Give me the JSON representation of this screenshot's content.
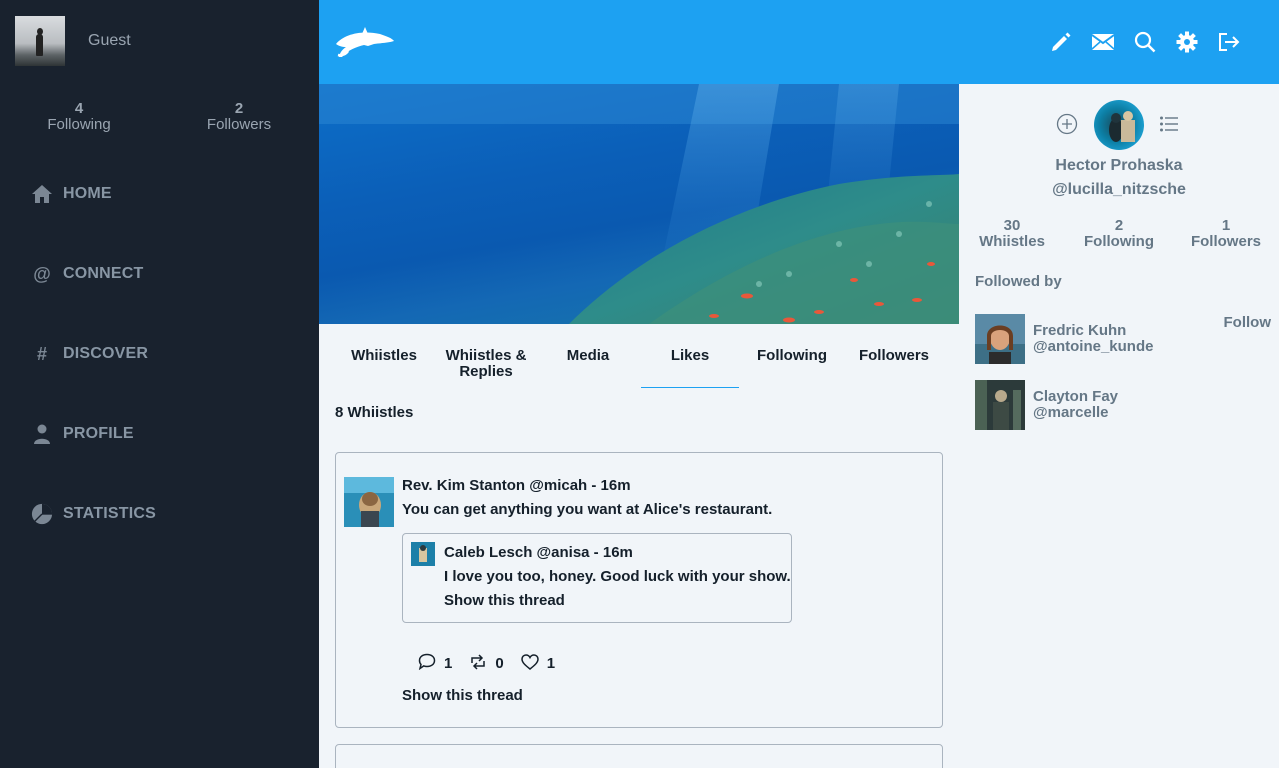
{
  "sidebar": {
    "guest_name": "Guest",
    "stats": [
      {
        "value": "4",
        "label": "Following"
      },
      {
        "value": "2",
        "label": "Followers"
      }
    ],
    "nav": [
      {
        "label": "HOME",
        "icon": "home-icon"
      },
      {
        "label": "CONNECT",
        "icon": "at-icon"
      },
      {
        "label": "DISCOVER",
        "icon": "hash-icon"
      },
      {
        "label": "PROFILE",
        "icon": "person-icon"
      },
      {
        "label": "STATISTICS",
        "icon": "pie-chart-icon"
      }
    ]
  },
  "topbar": {
    "icons": [
      "pencil-icon",
      "mail-icon",
      "search-icon",
      "gear-icon",
      "logout-icon"
    ]
  },
  "tabs": [
    {
      "label": "Whiistles"
    },
    {
      "label": "Whiistles & Replies"
    },
    {
      "label": "Media"
    },
    {
      "label": "Likes",
      "active": true
    },
    {
      "label": "Following"
    },
    {
      "label": "Followers"
    }
  ],
  "feed": {
    "count_label": "8 Whiistles",
    "post": {
      "meta": "Rev. Kim Stanton @micah - 16m",
      "text": "You can get anything you want at Alice's restaurant.",
      "quote": {
        "meta": "Caleb Lesch @anisa - 16m",
        "text": "I love you too, honey. Good luck with your show.",
        "show_thread": "Show this thread"
      },
      "replies": "1",
      "rewhiistles": "0",
      "likes": "1",
      "show_thread": "Show this thread"
    }
  },
  "profile": {
    "name": "Hector Prohaska",
    "handle": "@lucilla_nitzsche",
    "stats": [
      {
        "value": "30",
        "label": "Whiistles"
      },
      {
        "value": "2",
        "label": "Following"
      },
      {
        "value": "1",
        "label": "Followers"
      }
    ],
    "followed_by_label": "Followed by",
    "follow_label": "Follow",
    "followers": [
      {
        "name": "Fredric Kuhn",
        "handle": "@antoine_kunde"
      },
      {
        "name": "Clayton Fay",
        "handle": "@marcelle"
      }
    ]
  },
  "colors": {
    "brand": "#1da1f2",
    "sidebar": "#19222e",
    "background": "#f1f5f9"
  }
}
